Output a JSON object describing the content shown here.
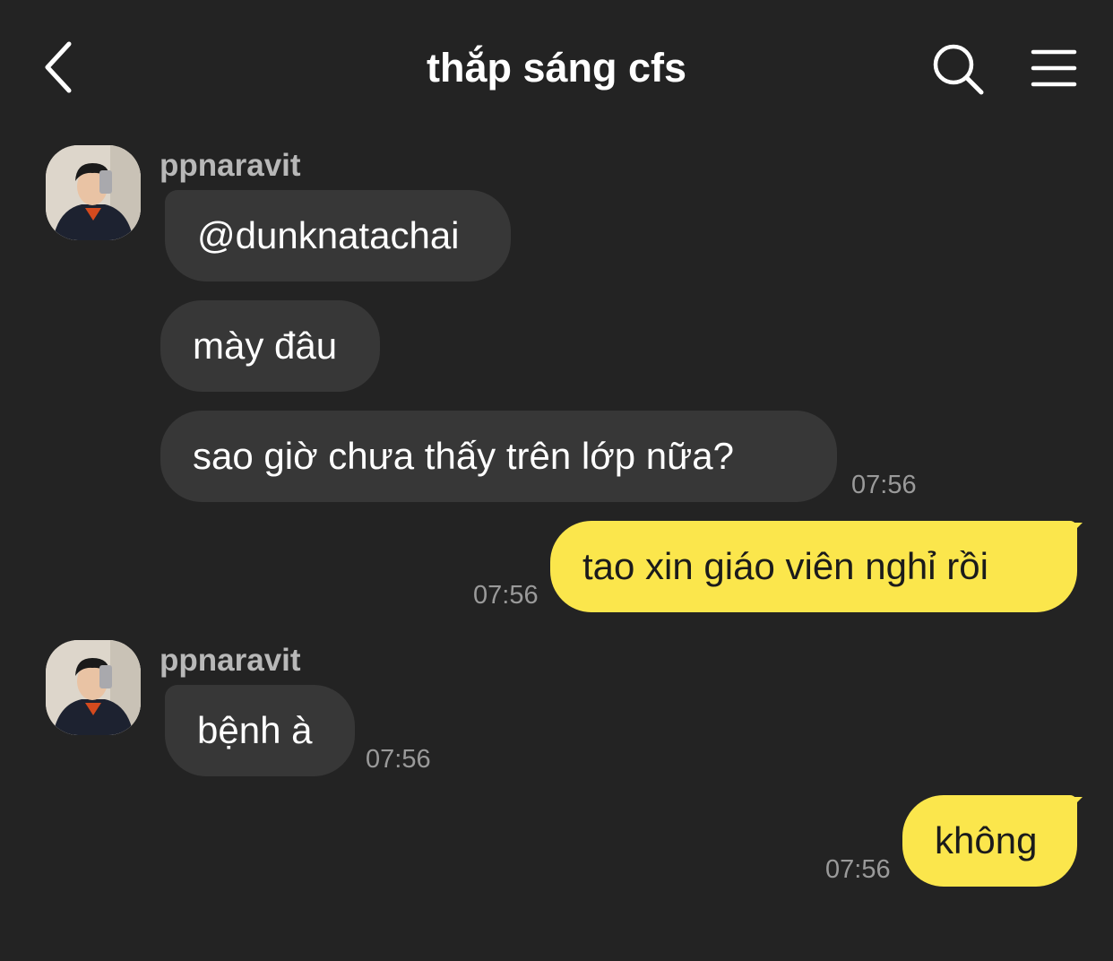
{
  "header": {
    "back_icon": "chevron-left-icon",
    "title": "thắp sáng cfs",
    "search_icon": "search-icon",
    "menu_icon": "hamburger-menu-icon"
  },
  "messages": {
    "group1": {
      "sender": "ppnaravit",
      "bubbles": [
        "@dunknatachai",
        "mày đâu",
        "sao giờ chưa thấy trên lớp nữa?"
      ],
      "time": "07:56"
    },
    "out1": {
      "text": "tao xin giáo viên nghỉ rồi",
      "time": "07:56"
    },
    "group2": {
      "sender": "ppnaravit",
      "bubbles": [
        "bệnh à"
      ],
      "time": "07:56"
    },
    "out2": {
      "text": "không",
      "time": "07:56"
    }
  },
  "colors": {
    "background": "#232323",
    "incoming_bubble": "#373737",
    "outgoing_bubble": "#fbe64c",
    "timestamp": "#9a9a9a"
  }
}
